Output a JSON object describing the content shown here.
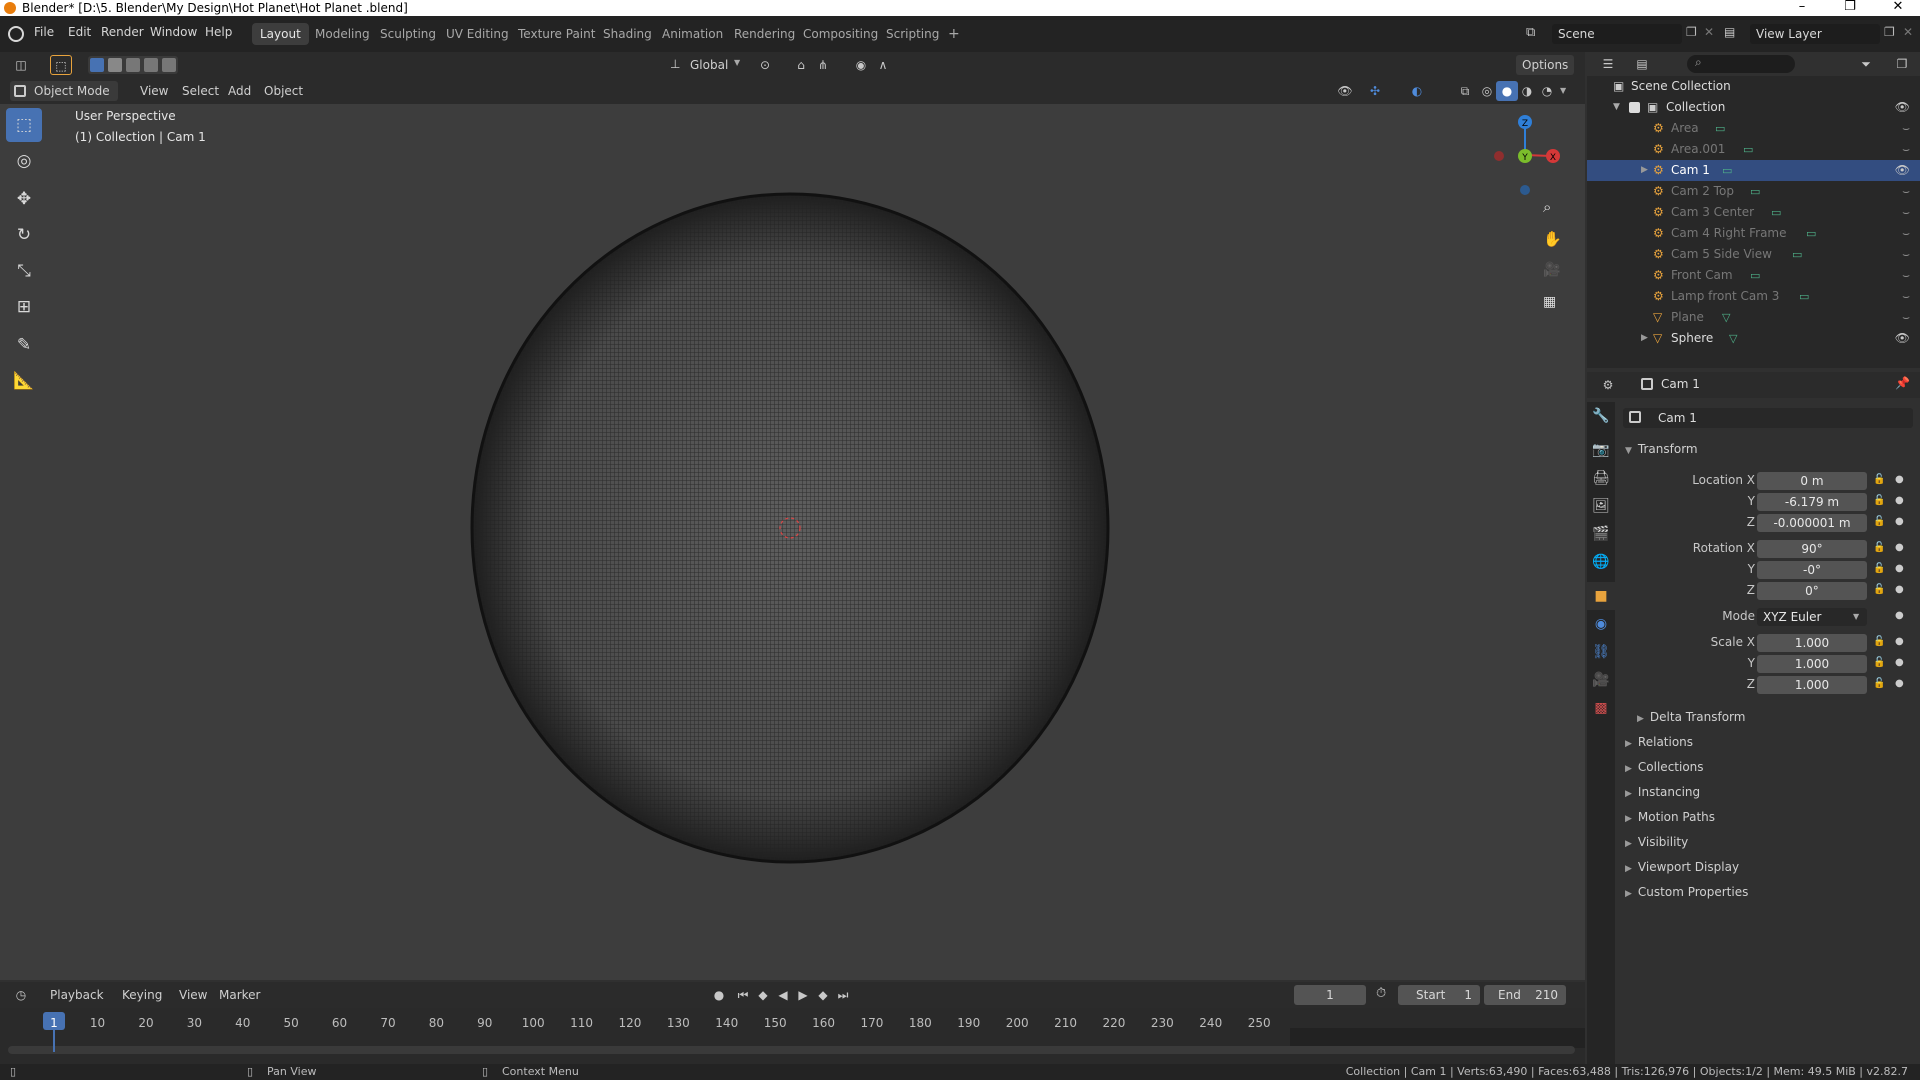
{
  "window": {
    "title": "Blender* [D:\\5. Blender\\My Design\\Hot Planet\\Hot Planet .blend]",
    "minimize": "–",
    "maximize": "❐",
    "close": "✕"
  },
  "menu": [
    "File",
    "Edit",
    "Render",
    "Window",
    "Help"
  ],
  "workspaces": [
    "Layout",
    "Modeling",
    "Sculpting",
    "UV Editing",
    "Texture Paint",
    "Shading",
    "Animation",
    "Rendering",
    "Compositing",
    "Scripting"
  ],
  "workspace_add": "+",
  "scene": {
    "name": "Scene",
    "view_layer": "View Layer"
  },
  "tool_header": {
    "orientation": "Global",
    "options": "Options"
  },
  "viewport_header": {
    "mode": "Object Mode",
    "menus": [
      "View",
      "Select",
      "Add",
      "Object"
    ]
  },
  "viewport": {
    "perspective": "User Perspective",
    "context": "(1) Collection | Cam 1",
    "gizmo": {
      "z": "Z",
      "y": "Y",
      "x": "X"
    }
  },
  "outliner": {
    "root": "Scene Collection",
    "collection": "Collection",
    "items": [
      {
        "name": "Area",
        "selected": false,
        "visible": false
      },
      {
        "name": "Area.001",
        "selected": false,
        "visible": false
      },
      {
        "name": "Cam 1",
        "selected": true,
        "visible": true
      },
      {
        "name": "Cam 2 Top",
        "selected": false,
        "visible": false
      },
      {
        "name": "Cam 3 Center",
        "selected": false,
        "visible": false
      },
      {
        "name": "Cam 4 Right Frame",
        "selected": false,
        "visible": false
      },
      {
        "name": "Cam 5 Side View",
        "selected": false,
        "visible": false
      },
      {
        "name": "Front Cam",
        "selected": false,
        "visible": false
      },
      {
        "name": "Lamp front Cam 3",
        "selected": false,
        "visible": false
      },
      {
        "name": "Plane",
        "selected": false,
        "visible": false
      },
      {
        "name": "Sphere",
        "selected": false,
        "visible": true
      }
    ]
  },
  "properties": {
    "object_name": "Cam 1",
    "data_name": "Cam 1",
    "transform_title": "Transform",
    "location": {
      "label": "Location X",
      "x": "0 m",
      "y": "-6.179 m",
      "z": "-0.000001 m"
    },
    "rotation": {
      "label": "Rotation X",
      "x": "90°",
      "y": "-0°",
      "z": "0°"
    },
    "mode_label": "Mode",
    "mode": "XYZ Euler",
    "scale": {
      "label": "Scale X",
      "x": "1.000",
      "y": "1.000",
      "z": "1.000"
    },
    "axis_y": "Y",
    "axis_z": "Z",
    "delta": "Delta Transform",
    "sections": [
      "Relations",
      "Collections",
      "Instancing",
      "Motion Paths",
      "Visibility",
      "Viewport Display",
      "Custom Properties"
    ]
  },
  "timeline": {
    "menus": [
      "Playback",
      "Keying",
      "View",
      "Marker"
    ],
    "current_frame": "1",
    "start_label": "Start",
    "start": "1",
    "end_label": "End",
    "end": "210",
    "ticks": [
      "1",
      "10",
      "20",
      "30",
      "40",
      "50",
      "60",
      "70",
      "80",
      "90",
      "100",
      "110",
      "120",
      "130",
      "140",
      "150",
      "160",
      "170",
      "180",
      "190",
      "200",
      "210",
      "220",
      "230",
      "240",
      "250"
    ]
  },
  "status": {
    "pan": "Pan View",
    "context_menu": "Context Menu",
    "info": "Collection | Cam 1 | Verts:63,490 | Faces:63,488 | Tris:126,976 | Objects:1/2 | Mem: 49.5 MiB | v2.82.7"
  },
  "colors": {
    "accent": "#4772b3",
    "selection": "#334d80",
    "blender_orange": "#e87d0d"
  }
}
